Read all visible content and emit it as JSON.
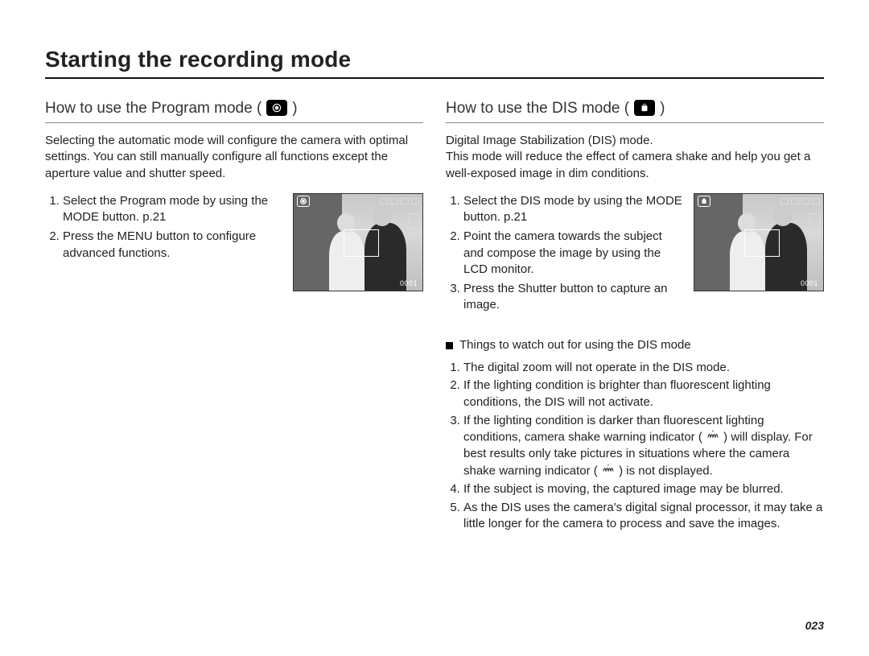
{
  "title": "Starting the recording mode",
  "page_number": "023",
  "left": {
    "heading_prefix": "How to use the Program mode (",
    "heading_suffix": " )",
    "mode_icon": "program-mode-icon",
    "blurb": "Selecting the automatic mode will configure the camera with optimal settings. You can still manually configure all functions except the aperture value and shutter speed.",
    "steps": [
      "Select the Program mode by using the MODE button. p.21",
      "Press the MENU button to configure advanced functions."
    ],
    "lcd_counter": "0001"
  },
  "right": {
    "heading_prefix": "How to use the DIS mode (",
    "heading_suffix": " )",
    "mode_icon": "dis-mode-icon",
    "blurb": "Digital Image Stabilization (DIS) mode.\nThis mode will reduce the effect of camera shake and help you get a well-exposed image in dim conditions.",
    "steps": [
      "Select the DIS mode by using the MODE button. p.21",
      "Point the camera towards the subject and compose the image by using the LCD monitor.",
      "Press the Shutter button to capture an image."
    ],
    "lcd_counter": "0001",
    "note_heading": "Things to watch out for using the DIS mode",
    "notes": [
      "The digital zoom will not operate in the DIS mode.",
      "If the lighting condition is brighter than fluorescent lighting conditions, the DIS will not activate.",
      {
        "pre": "If the lighting condition is darker than fluorescent lighting conditions, camera shake warning indicator ( ",
        "mid": " ) will display. For best results only take pictures in situations where the camera shake warning indicator ( ",
        "post": " ) is not displayed."
      },
      "If the subject is moving, the captured image may be blurred.",
      "As the DIS uses the camera's digital signal processor, it may take a little longer for the camera to process and save the images."
    ]
  }
}
